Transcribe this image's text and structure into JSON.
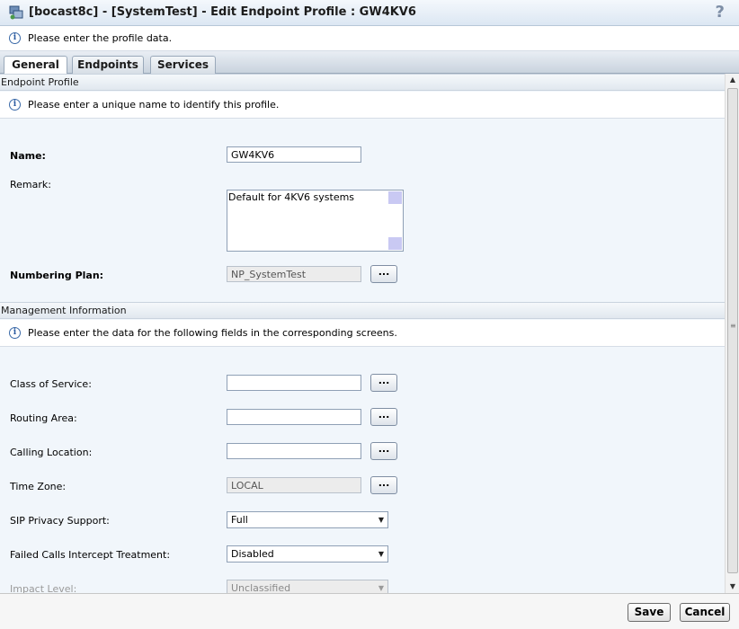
{
  "window": {
    "title": "[bocast8c] - [SystemTest] - Edit Endpoint Profile : GW4KV6",
    "help_glyph": "?"
  },
  "info_bar": {
    "message": "Please enter the profile data."
  },
  "tabs": [
    {
      "label": "General",
      "active": true
    },
    {
      "label": "Endpoints",
      "active": false
    },
    {
      "label": "Services",
      "active": false
    }
  ],
  "endpoint_profile": {
    "header": "Endpoint Profile",
    "info": "Please enter a unique name to identify this profile.",
    "name_label": "Name:",
    "name_value": "GW4KV6",
    "remark_label": "Remark:",
    "remark_value": "Default for 4KV6 systems",
    "numbering_plan_label": "Numbering Plan:",
    "numbering_plan_value": "NP_SystemTest",
    "browse_label": "..."
  },
  "management": {
    "header": "Management Information",
    "info": "Please enter the data for the following fields in the corresponding screens.",
    "class_of_service_label": "Class of Service:",
    "class_of_service_value": "",
    "routing_area_label": "Routing Area:",
    "routing_area_value": "",
    "calling_location_label": "Calling Location:",
    "calling_location_value": "",
    "time_zone_label": "Time Zone:",
    "time_zone_value": "LOCAL",
    "sip_privacy_label": "SIP Privacy Support:",
    "sip_privacy_value": "Full",
    "failed_calls_label": "Failed Calls Intercept Treatment:",
    "failed_calls_value": "Disabled",
    "impact_level_label": "Impact Level:",
    "impact_level_value": "Unclassified",
    "browse_label": "..."
  },
  "footer": {
    "save_label": "Save",
    "cancel_label": "Cancel"
  },
  "colors": {
    "title_gradient": "#dce7f3",
    "content_bg": "#f1f6fb",
    "info_icon": "#2a5aa0"
  },
  "icons": {
    "app": "network-profile-icon",
    "info": "info-icon",
    "help": "help-icon",
    "dropdown": "chevron-down-icon"
  }
}
